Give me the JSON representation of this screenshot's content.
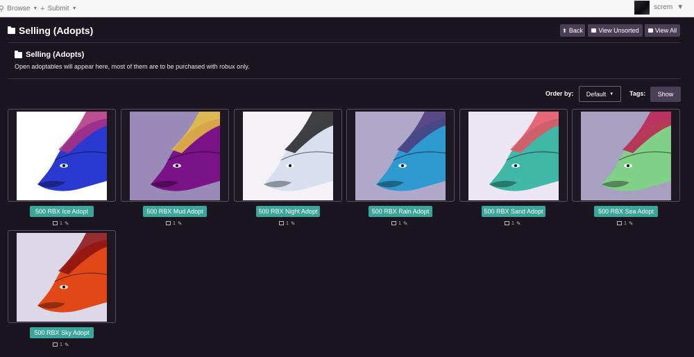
{
  "topnav": {
    "browse_label": "Browse",
    "submit_label": "Submit",
    "username": "screm"
  },
  "header": {
    "title": "Selling (Adopts)",
    "buttons": {
      "back": "Back",
      "view_unsorted": "View Unsorted",
      "view_all": "View All"
    }
  },
  "section": {
    "title": "Selling (Adopts)",
    "description": "Open adoptables will appear here, most of them are to be purchased with robux only."
  },
  "controls": {
    "order_by_label": "Order by:",
    "order_value": "Default",
    "tags_label": "Tags:",
    "show_button": "Show"
  },
  "items": [
    {
      "title": "500 RBX Ice Adopt",
      "image_count": "1",
      "bg": "#ffffff",
      "main": "#2a3ad0",
      "accent": "#b03080"
    },
    {
      "title": "500 RBX Mud Adopt",
      "image_count": "1",
      "bg": "#9a8ab8",
      "main": "#7a1288",
      "accent": "#e8c040"
    },
    {
      "title": "500 RBX Night Adopt",
      "image_count": "1",
      "bg": "#f4f2f6",
      "main": "#d8e0f0",
      "accent": "#222222"
    },
    {
      "title": "500 RBX Rain Adopt",
      "image_count": "1",
      "bg": "#b0a8c8",
      "main": "#2f9ad0",
      "accent": "#4a3a7a"
    },
    {
      "title": "500 RBX Sand Adopt",
      "image_count": "1",
      "bg": "#ece6f2",
      "main": "#3fb8a8",
      "accent": "#e85060"
    },
    {
      "title": "500 RBX Sea Adopt",
      "image_count": "1",
      "bg": "#a8a0c0",
      "main": "#80d088",
      "accent": "#c02050"
    },
    {
      "title": "500 RBX Sky Adopt",
      "image_count": "1",
      "bg": "#ddd8e8",
      "main": "#e04818",
      "accent": "#8a1010"
    }
  ]
}
